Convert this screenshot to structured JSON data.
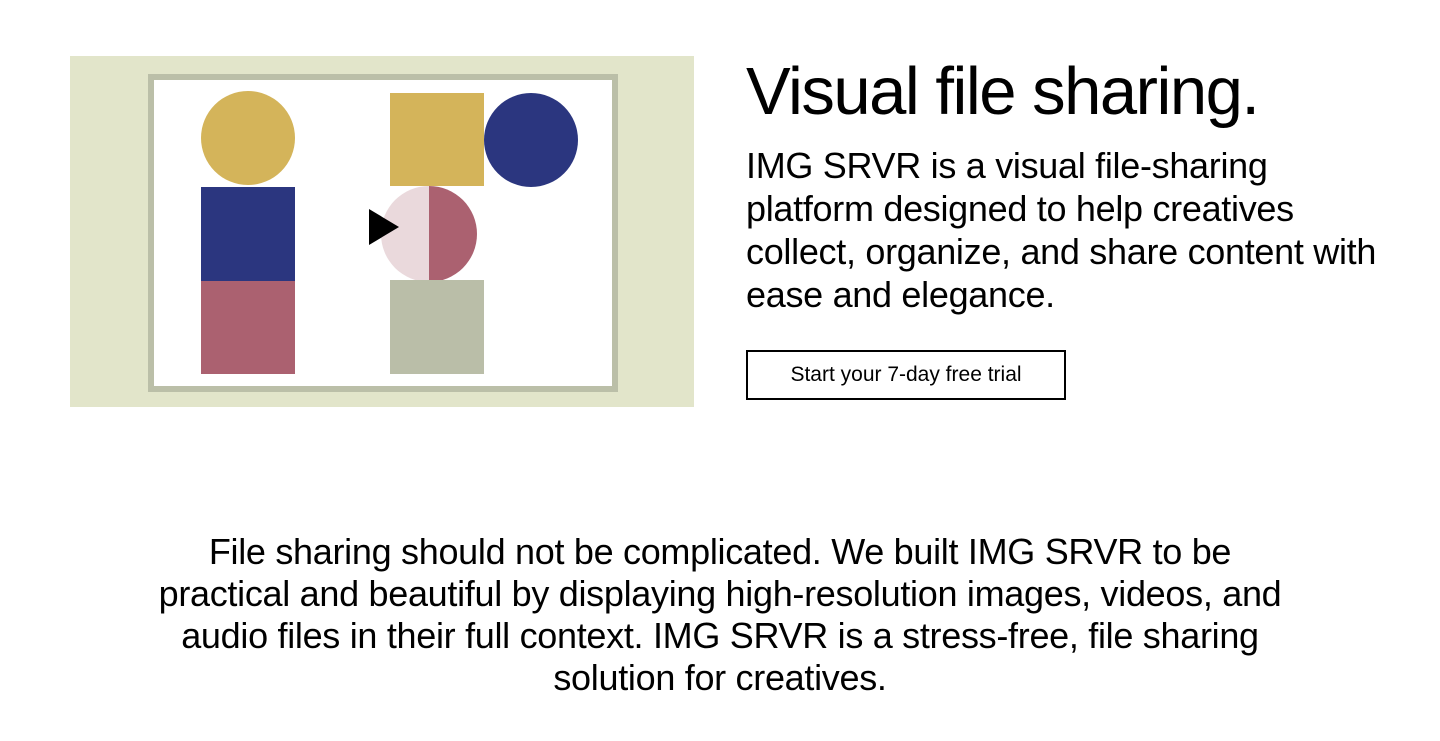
{
  "hero": {
    "title": "Visual file sharing.",
    "intro": "IMG SRVR is a visual file-sharing platform designed to help creatives collect, organize, and share content with ease and elegance.",
    "cta_label": "Start your 7-day free trial"
  },
  "media": {
    "icon": "play-icon",
    "colors": {
      "background": "#e2e5ca",
      "frame": "#bbbfa8",
      "mustard": "#d4b45a",
      "navy": "#2b367f",
      "rose": "#ab6170",
      "blush": "#ead9dc",
      "sage": "#babea8",
      "cream": "#f5efd9"
    }
  },
  "description": "File sharing should not be complicated. We built IMG SRVR to be practical and beautiful by displaying high-resolution images, videos, and audio files in their full context. IMG SRVR is a stress-free, file sharing solution for creatives."
}
